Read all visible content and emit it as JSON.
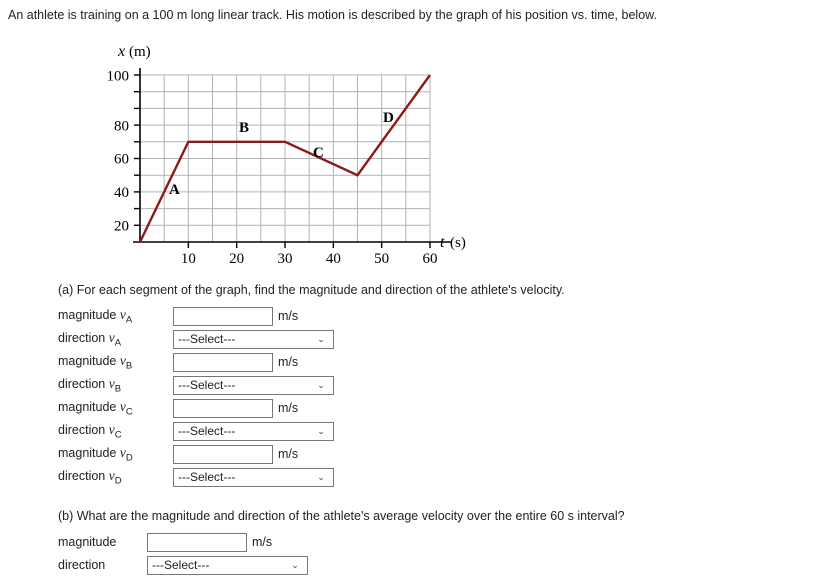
{
  "intro": {
    "text": "An athlete is training on a 100 m long linear track. His motion is described by the graph of his position vs. time, below."
  },
  "graph": {
    "y_axis_label_var": "x",
    "y_axis_label_unit": "(m)",
    "x_axis_label_var": "t",
    "x_axis_label_unit": "(s)",
    "y_ticks": [
      "20",
      "40",
      "60",
      "80",
      "100"
    ],
    "x_ticks": [
      "10",
      "20",
      "30",
      "40",
      "50",
      "60"
    ],
    "segment_labels": [
      "A",
      "B",
      "C",
      "D"
    ],
    "line_color": "#8B1A1A",
    "grid_color": "#b3b3b3",
    "axis_color": "#000000"
  },
  "chart_data": {
    "type": "line",
    "title": "",
    "xlabel": "t (s)",
    "ylabel": "x (m)",
    "xlim": [
      0,
      60
    ],
    "ylim": [
      0,
      100
    ],
    "xticks": [
      10,
      20,
      30,
      40,
      50,
      60
    ],
    "yticks": [
      20,
      40,
      60,
      80,
      100
    ],
    "grid": true,
    "grid_minor_x_step": 5,
    "grid_minor_y_step": 10,
    "legend": "none",
    "series": [
      {
        "name": "position",
        "color": "#8B1A1A",
        "x": [
          0,
          10,
          30,
          45,
          60
        ],
        "y": [
          0,
          60,
          60,
          40,
          100
        ]
      }
    ],
    "annotations": [
      {
        "label": "A",
        "x": 6.5,
        "y": 31
      },
      {
        "label": "B",
        "x": 22.5,
        "y": 66
      },
      {
        "label": "C",
        "x": 36.5,
        "y": 55
      },
      {
        "label": "D",
        "x": 50.5,
        "y": 76
      }
    ]
  },
  "question_a": {
    "prompt": "(a) For each segment of the graph, find the magnitude and direction of the athlete's velocity.",
    "rows": [
      {
        "kind": "magnitude",
        "label_text": "magnitude",
        "sub": "A",
        "value": "",
        "unit": "m/s"
      },
      {
        "kind": "direction",
        "label_text": "direction",
        "sub": "A",
        "value": "---Select---"
      },
      {
        "kind": "magnitude",
        "label_text": "magnitude",
        "sub": "B",
        "value": "",
        "unit": "m/s"
      },
      {
        "kind": "direction",
        "label_text": "direction",
        "sub": "B",
        "value": "---Select---"
      },
      {
        "kind": "magnitude",
        "label_text": "magnitude",
        "sub": "C",
        "value": "",
        "unit": "m/s"
      },
      {
        "kind": "direction",
        "label_text": "direction",
        "sub": "C",
        "value": "---Select---"
      },
      {
        "kind": "magnitude",
        "label_text": "magnitude",
        "sub": "D",
        "value": "",
        "unit": "m/s"
      },
      {
        "kind": "direction",
        "label_text": "direction",
        "sub": "D",
        "value": "---Select---"
      }
    ]
  },
  "question_b": {
    "prompt": "(b) What are the magnitude and direction of the athlete's average velocity over the entire 60 s interval?",
    "magnitude_label": "magnitude",
    "magnitude_value": "",
    "magnitude_unit": "m/s",
    "direction_label": "direction",
    "direction_value": "---Select---"
  },
  "select_arrow_glyph": "⌄"
}
